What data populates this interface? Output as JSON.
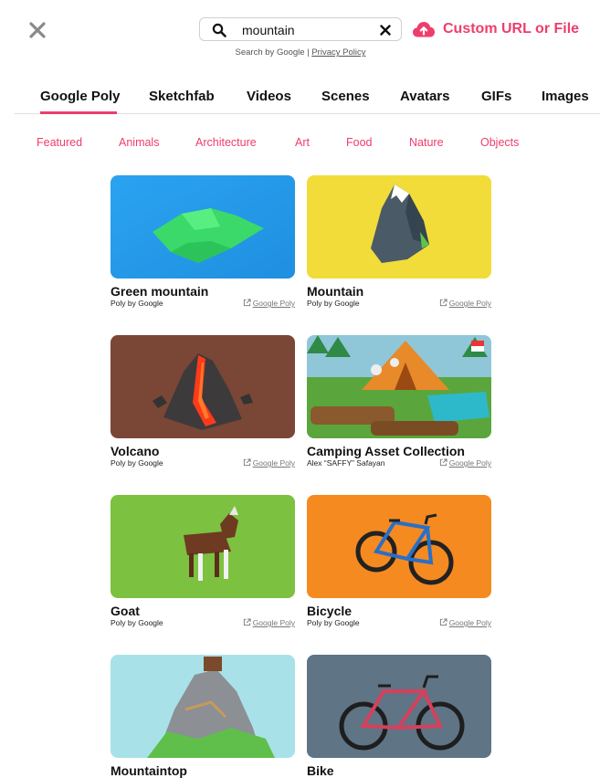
{
  "search": {
    "query": "mountain",
    "meta_prefix": "Search by Google | ",
    "privacy_label": "Privacy Policy"
  },
  "custom_url_label": "Custom URL or File",
  "tabs": [
    {
      "label": "Google Poly",
      "active": true
    },
    {
      "label": "Sketchfab"
    },
    {
      "label": "Videos"
    },
    {
      "label": "Scenes"
    },
    {
      "label": "Avatars"
    },
    {
      "label": "GIFs"
    },
    {
      "label": "Images"
    }
  ],
  "categories": [
    "Featured",
    "Animals",
    "Architecture",
    "Art",
    "Food",
    "Nature",
    "Objects"
  ],
  "results": [
    {
      "title": "Green mountain",
      "author": "Poly by Google",
      "source": "Google Poly",
      "icon": "green-mountain-thumbnail"
    },
    {
      "title": "Mountain",
      "author": "Poly by Google",
      "source": "Google Poly",
      "icon": "mountain-thumbnail"
    },
    {
      "title": "Volcano",
      "author": "Poly by Google",
      "source": "Google Poly",
      "icon": "volcano-thumbnail"
    },
    {
      "title": "Camping Asset Collection",
      "author": "Alex “SAFFY” Safayan",
      "source": "Google Poly",
      "icon": "camping-thumbnail"
    },
    {
      "title": "Goat",
      "author": "Poly by Google",
      "source": "Google Poly",
      "icon": "goat-thumbnail"
    },
    {
      "title": "Bicycle",
      "author": "Poly by Google",
      "source": "Google Poly",
      "icon": "bicycle-thumbnail"
    },
    {
      "title": "Mountaintop",
      "author": "",
      "source": "",
      "icon": "mountaintop-thumbnail"
    },
    {
      "title": "Bike",
      "author": "",
      "source": "",
      "icon": "bike-thumbnail"
    }
  ],
  "colors": {
    "accent": "#ef3d6b",
    "text": "#111111",
    "divider": "#dedede"
  }
}
